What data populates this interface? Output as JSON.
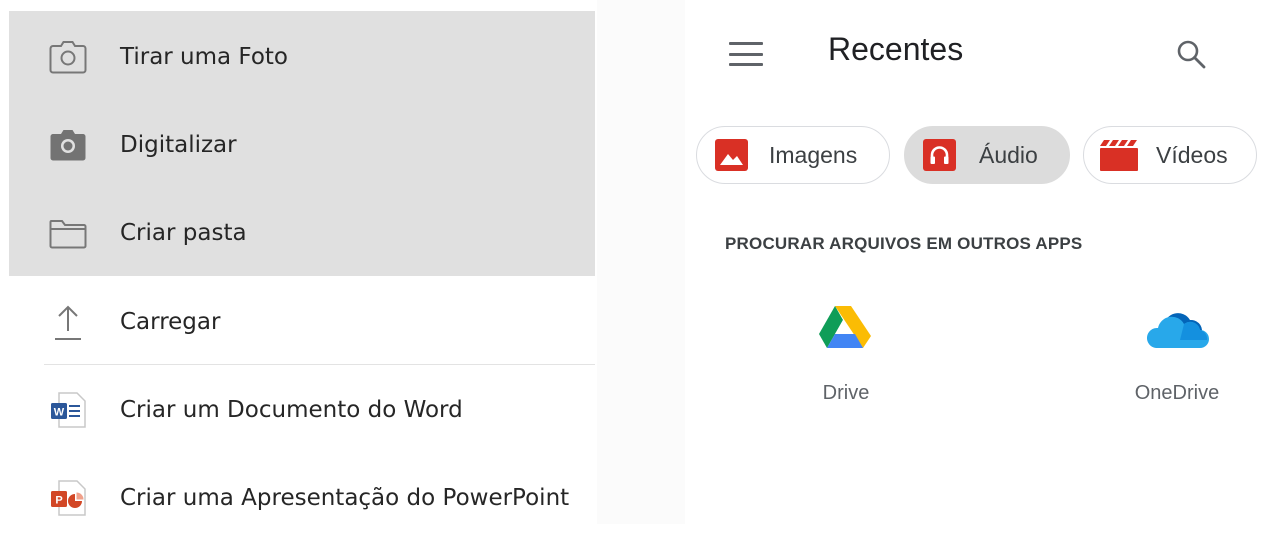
{
  "menu": {
    "items": [
      {
        "label": "Tirar uma Foto",
        "icon": "camera-outline-icon"
      },
      {
        "label": "Digitalizar",
        "icon": "camera-filled-icon"
      },
      {
        "label": "Criar pasta",
        "icon": "folder-icon"
      },
      {
        "label": "Carregar",
        "icon": "upload-icon"
      },
      {
        "label": "Criar um Documento do Word",
        "icon": "word-icon"
      },
      {
        "label": "Criar uma Apresentação do PowerPoint",
        "icon": "powerpoint-icon"
      }
    ]
  },
  "picker": {
    "title": "Recentes",
    "chips": [
      {
        "label": "Imagens",
        "icon": "image-icon",
        "active": false
      },
      {
        "label": "Áudio",
        "icon": "headphones-icon",
        "active": true
      },
      {
        "label": "Vídeos",
        "icon": "clapperboard-icon",
        "active": false
      }
    ],
    "section_title": "PROCURAR ARQUIVOS EM OUTROS APPS",
    "apps": [
      {
        "label": "Drive",
        "icon": "google-drive-icon"
      },
      {
        "label": "OneDrive",
        "icon": "onedrive-icon"
      }
    ]
  },
  "colors": {
    "highlight": "#e0e0e0",
    "word_blue": "#2b579a",
    "powerpoint_red": "#d24726",
    "chip_red": "#d93025"
  }
}
